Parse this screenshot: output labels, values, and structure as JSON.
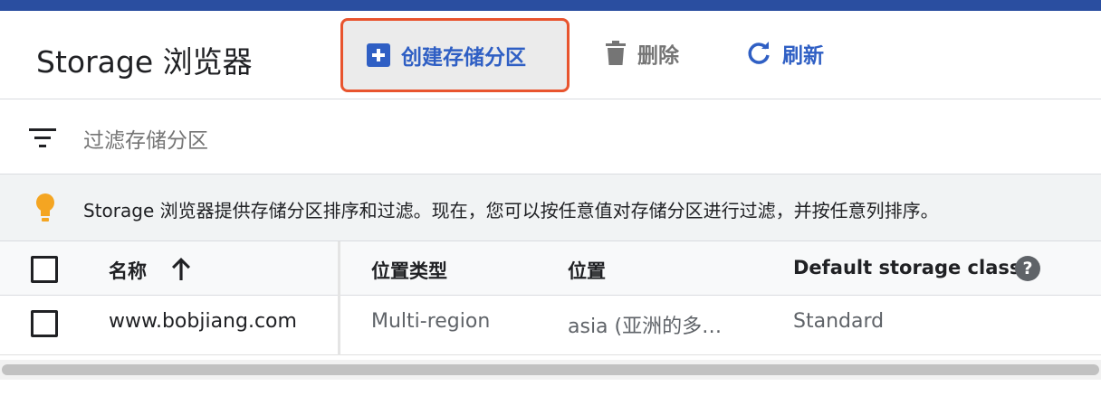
{
  "toolbar": {
    "title": "Storage 浏览器",
    "create_label": "创建存储分区",
    "delete_label": "删除",
    "refresh_label": "刷新"
  },
  "filter": {
    "placeholder": "过滤存储分区"
  },
  "info": {
    "text": "Storage 浏览器提供存储分区排序和过滤。现在，您可以按任意值对存储分区进行过滤，并按任意列排序。"
  },
  "table": {
    "headers": {
      "name": "名称",
      "location_type": "位置类型",
      "location": "位置",
      "storage_class": "Default storage class"
    },
    "rows": [
      {
        "name": "www.bobjiang.com",
        "location_type": "Multi-region",
        "location": "asia (亚洲的多…",
        "storage_class": "Standard"
      }
    ]
  },
  "colors": {
    "accent_bar": "#2a4ea0",
    "primary": "#2f5fc4",
    "highlight_border": "#e8542e",
    "bulb": "#f4a522"
  }
}
